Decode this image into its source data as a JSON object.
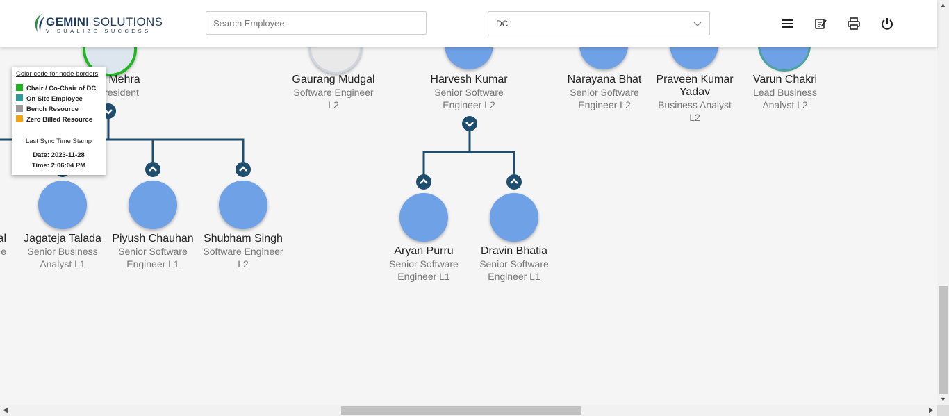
{
  "header": {
    "logo_main_bold": "GEMINI",
    "logo_main_rest": "SOLUTIONS",
    "logo_tagline": "VISUALIZE SUCCESS",
    "search_placeholder": "Search Employee",
    "dept_select_value": "DC",
    "icons": [
      "menu-icon",
      "notes-icon",
      "print-icon",
      "power-icon"
    ]
  },
  "legend": {
    "title": "Color code for node borders",
    "items": [
      {
        "label": "Chair / Co-Chair of DC",
        "color": "#22b522"
      },
      {
        "label": "On Site Employee",
        "color": "#2f9a9a"
      },
      {
        "label": "Bench Resource",
        "color": "#9a9a9a"
      },
      {
        "label": "Zero Billed Resource",
        "color": "#f2a21a"
      }
    ],
    "sync_title": "Last Sync Time Stamp",
    "sync_date": "Date: 2023-11-28",
    "sync_time": "Time: 2:06:04 PM"
  },
  "top_nodes": [
    {
      "name": "j Mehra",
      "designation_lines": [
        "resident"
      ]
    },
    {
      "name": "Gaurang Mudgal",
      "designation_lines": [
        "Software Engineer",
        "L2"
      ]
    },
    {
      "name": "Harvesh Kumar",
      "designation_lines": [
        "Senior Software",
        "Engineer L2"
      ]
    },
    {
      "name": "Narayana Bhat",
      "designation_lines": [
        "Senior Software",
        "Engineer L2"
      ]
    },
    {
      "name": "Praveen Kumar",
      "name_line2": "Yadav",
      "designation_lines": [
        "Business Analyst",
        "L2"
      ]
    },
    {
      "name": "Varun Chakri",
      "designation_lines": [
        "Lead Business",
        "Analyst L2"
      ]
    }
  ],
  "child_nodes": [
    {
      "name": "al",
      "designation_lines": [
        "e"
      ]
    },
    {
      "name": "Jagateja Talada",
      "designation_lines": [
        "Senior Business",
        "Analyst L1"
      ]
    },
    {
      "name": "Piyush Chauhan",
      "designation_lines": [
        "Senior Software",
        "Engineer L1"
      ]
    },
    {
      "name": "Shubham Singh",
      "designation_lines": [
        "Software Engineer",
        "L2"
      ]
    },
    {
      "name": "Aryan Purru",
      "designation_lines": [
        "Senior Software",
        "Engineer L1"
      ]
    },
    {
      "name": "Dravin Bhatia",
      "designation_lines": [
        "Senior Software",
        "Engineer L1"
      ]
    }
  ],
  "colors": {
    "accent": "#1e4d6e",
    "avatar_fill": "#6fa1e6",
    "chair_border": "#22b522",
    "onsite_border": "#2f9a9a"
  }
}
